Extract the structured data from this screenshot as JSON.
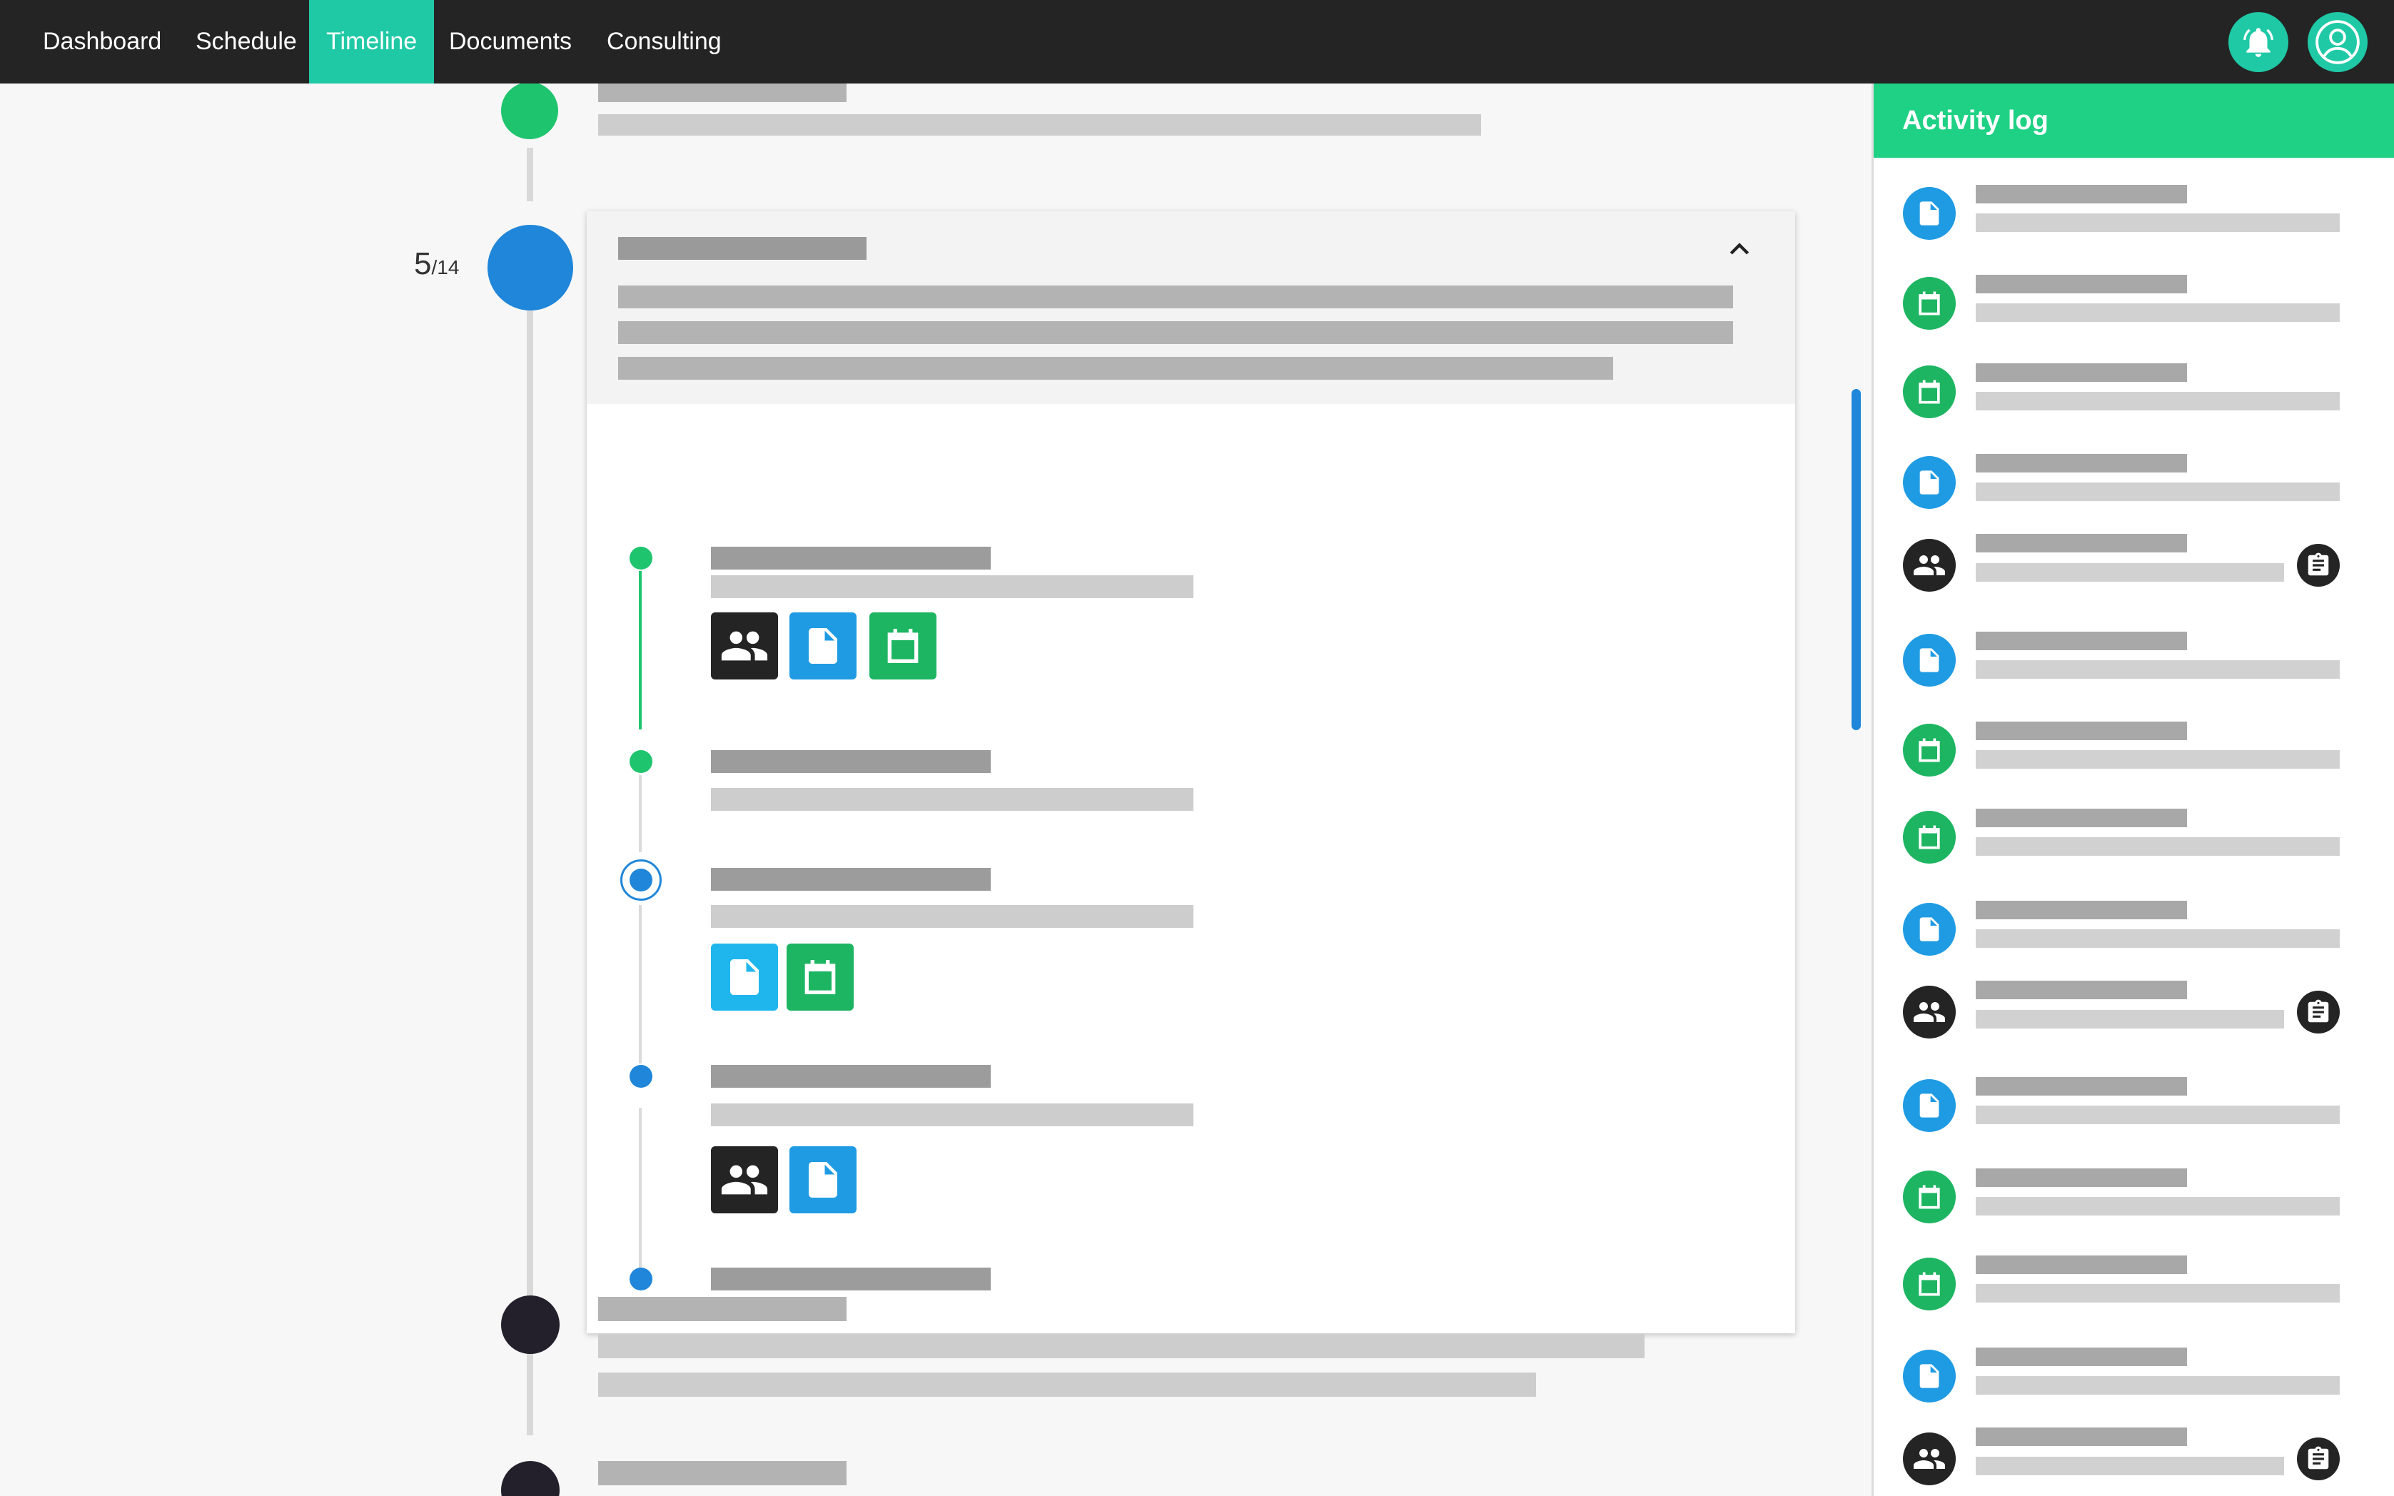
{
  "nav": {
    "items": [
      {
        "label": "Dashboard",
        "active": false
      },
      {
        "label": "Schedule",
        "active": false
      },
      {
        "label": "Timeline",
        "active": true
      },
      {
        "label": "Documents",
        "active": false
      },
      {
        "label": "Consulting",
        "active": false
      }
    ],
    "notification_icon": "bell-icon",
    "profile_icon": "user-avatar-icon"
  },
  "timeline": {
    "position": "5",
    "total": "/14",
    "current_step_number": 5,
    "total_steps": 14,
    "expanded_card_toggle_icon": "chevron-up-icon",
    "sub_steps": [
      {
        "status": "completed",
        "attachments": [
          "group-icon",
          "document-icon",
          "calendar-icon"
        ]
      },
      {
        "status": "completed",
        "attachments": []
      },
      {
        "status": "current",
        "attachments": [
          "document-icon",
          "calendar-icon"
        ]
      },
      {
        "status": "upcoming",
        "attachments": [
          "group-icon",
          "document-icon"
        ]
      },
      {
        "status": "upcoming",
        "attachments": []
      }
    ]
  },
  "activity_log": {
    "title": "Activity log",
    "items": [
      {
        "type": "document",
        "icon": "document-icon"
      },
      {
        "type": "calendar",
        "icon": "calendar-icon"
      },
      {
        "type": "calendar",
        "icon": "calendar-icon"
      },
      {
        "type": "document",
        "icon": "document-icon"
      },
      {
        "type": "group",
        "icon": "group-icon",
        "badge": "clipboard-icon"
      },
      {
        "type": "document",
        "icon": "document-icon"
      },
      {
        "type": "calendar",
        "icon": "calendar-icon"
      },
      {
        "type": "calendar",
        "icon": "calendar-icon"
      },
      {
        "type": "document",
        "icon": "document-icon"
      },
      {
        "type": "group",
        "icon": "group-icon",
        "badge": "clipboard-icon"
      },
      {
        "type": "document",
        "icon": "document-icon"
      },
      {
        "type": "calendar",
        "icon": "calendar-icon"
      },
      {
        "type": "calendar",
        "icon": "calendar-icon"
      },
      {
        "type": "document",
        "icon": "document-icon"
      },
      {
        "type": "group",
        "icon": "group-icon",
        "badge": "clipboard-icon"
      }
    ]
  },
  "colors": {
    "accent_teal": "#1fc9a6",
    "log_header_green": "#1fd184",
    "completed_green": "#1fc46e",
    "current_blue": "#1f86d9",
    "document_blue": "#1f9be3",
    "calendar_green": "#1db562",
    "group_dark": "#242424",
    "future_dark": "#23202b"
  }
}
